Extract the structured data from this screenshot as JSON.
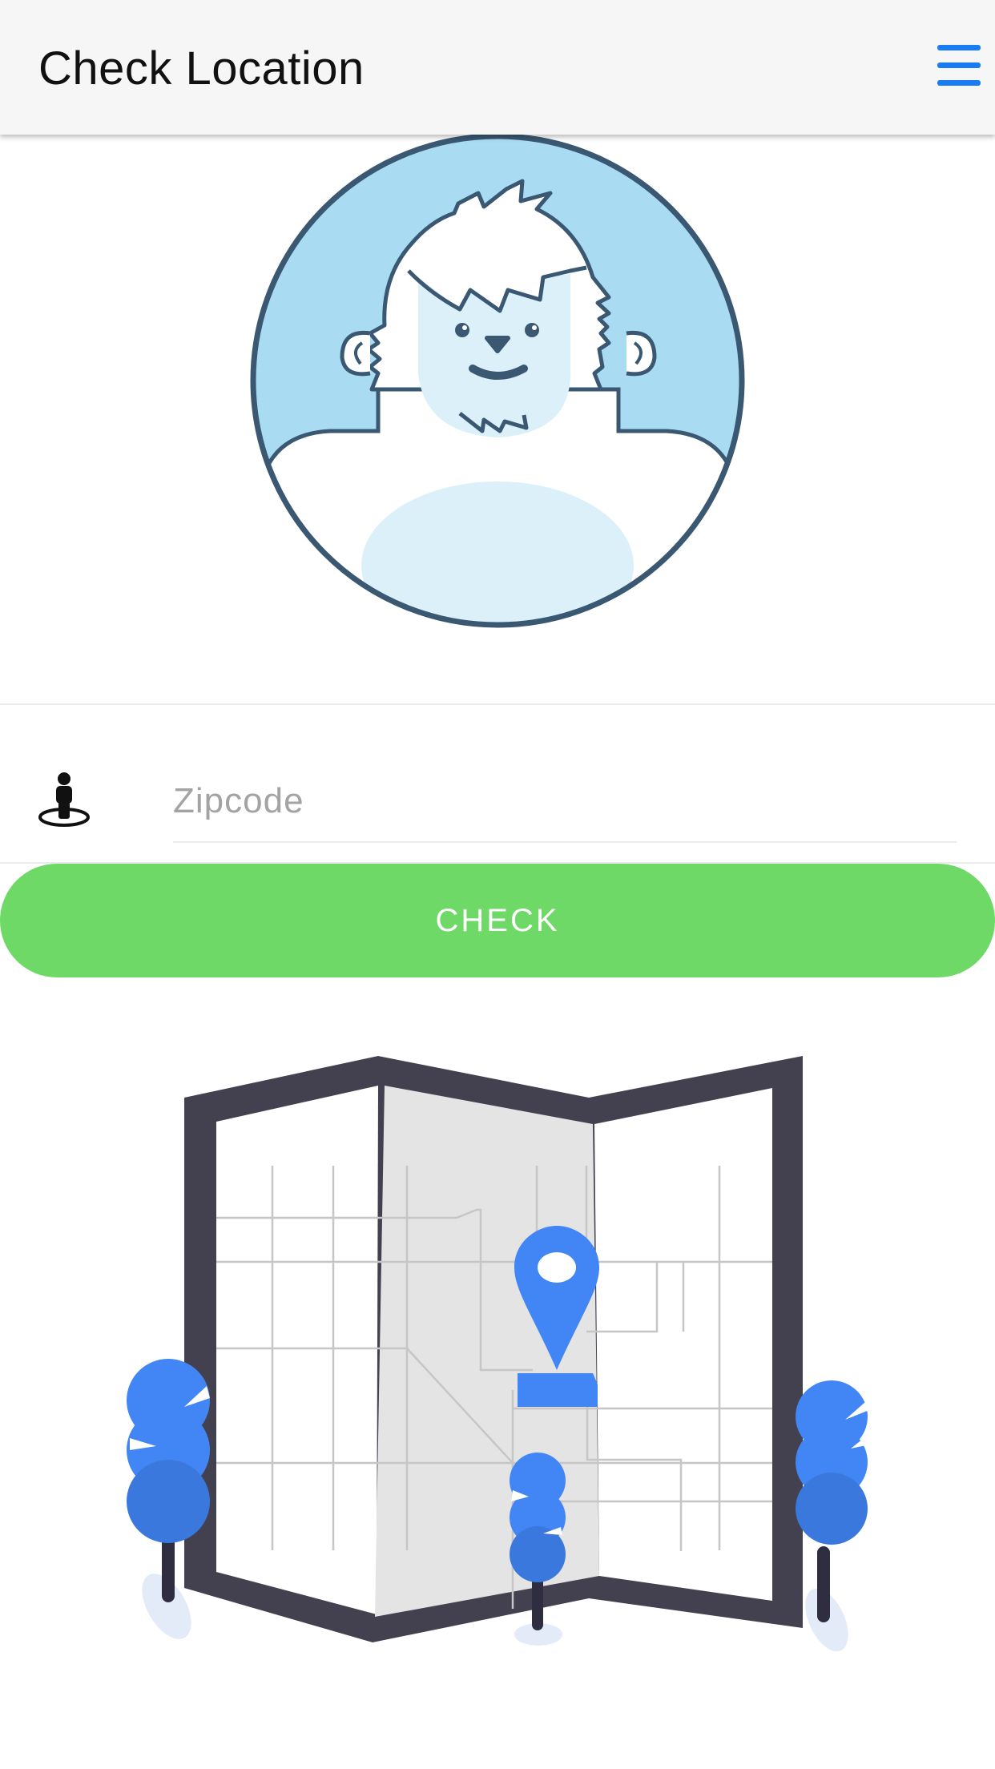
{
  "header": {
    "title": "Check Location",
    "menu_icon": "hamburger-menu-icon"
  },
  "avatar": {
    "icon": "yeti-avatar-illustration"
  },
  "form": {
    "location_icon": "street-view-person-icon",
    "zipcode_placeholder": "Zipcode",
    "zipcode_value": "",
    "check_label": "CHECK"
  },
  "illustration": {
    "icon": "folded-map-with-pin-illustration"
  },
  "colors": {
    "header_bg": "#f6f6f6",
    "menu_accent": "#1a7cf3",
    "check_button": "#6ed967",
    "avatar_sky": "#a9dcf2",
    "avatar_outline": "#3a5872",
    "map_frame": "#43404f",
    "pin_blue": "#4285f4"
  }
}
